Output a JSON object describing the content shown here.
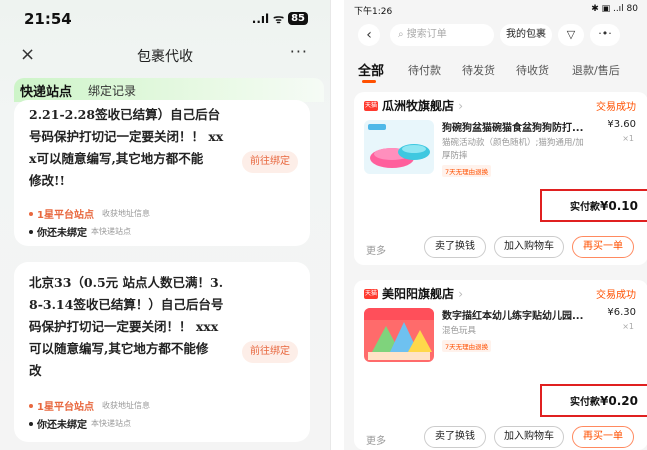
{
  "left": {
    "status_bar": {
      "time": "21:54",
      "signal": "..ıl",
      "wifi": "ᯤ",
      "battery": "85"
    },
    "nav": {
      "close": "×",
      "title": "包裹代收",
      "more": "···"
    },
    "tabs": [
      {
        "label": "快递站点"
      },
      {
        "label": "绑定记录"
      }
    ],
    "cards": [
      {
        "lines": [
          "2.21-2.28签收已结算）自己后台",
          "号码保护打切记一定要关闭！！ xx",
          "x可以随意编写,其它地方都不能",
          "修改!!"
        ],
        "bind_button": "前往绑定",
        "site_name": "1星平台站点",
        "site_note": "收获地址信息",
        "unbound_text": "你还未绑定",
        "unbound_note": "本快递站点"
      },
      {
        "lines": [
          "北京33（0.5元 站点人数已满！3.",
          "8-3.14签收已结算！）自己后台号",
          "码保护打切记一定要关闭！！ xxx",
          "可以随意编写,其它地方都不能修",
          "改"
        ],
        "bind_button": "前往绑定",
        "site_name": "1星平台站点",
        "site_note": "收获地址信息",
        "unbound_text": "你还未绑定",
        "unbound_note": "本快递站点"
      }
    ]
  },
  "right": {
    "status_bar": {
      "time": "下午1:26",
      "icons": "✱ ▣ ..ıl 80"
    },
    "nav": {
      "back": "‹",
      "search_placeholder": "搜索订单",
      "my_parcel": "我的包裹",
      "filter": "▽",
      "more": "·•·"
    },
    "tabs": [
      {
        "label": "全部"
      },
      {
        "label": "待付款"
      },
      {
        "label": "待发货"
      },
      {
        "label": "待收货"
      },
      {
        "label": "退款/售后"
      }
    ],
    "accent_color": "#ff5000",
    "orders": [
      {
        "shop": "瓜洲牧旗舰店",
        "status": "交易成功",
        "title": "狗碗狗盆猫碗猫食盆狗狗防打...",
        "price": "¥3.60",
        "qty": "×1",
        "spec": "猫碗活动款（颜色随机）;猫狗通用/加厚防摔",
        "badge": "7天无理由退换",
        "pay_label": "实付款",
        "pay_amount": "¥0.10",
        "more": "更多",
        "buttons": [
          "卖了换钱",
          "加入购物车",
          "再买一单"
        ]
      },
      {
        "shop": "美阳阳旗舰店",
        "status": "交易成功",
        "title": "数字描红本幼儿练字贴幼儿园...",
        "price": "¥6.30",
        "qty": "×1",
        "spec": "混色玩具",
        "badge": "7天无理由退换",
        "pay_label": "实付款",
        "pay_amount": "¥0.20",
        "more": "更多",
        "buttons": [
          "卖了换钱",
          "加入购物车",
          "再买一单"
        ]
      }
    ]
  }
}
